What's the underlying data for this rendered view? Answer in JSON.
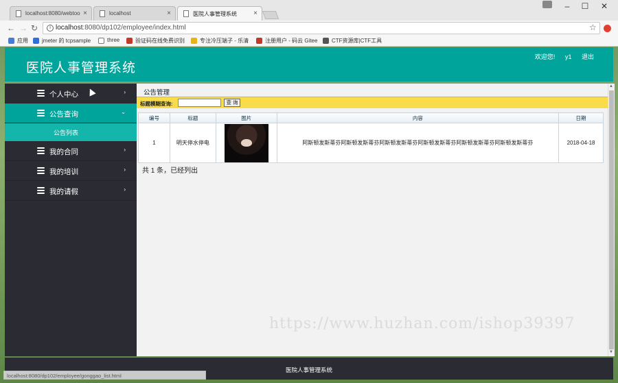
{
  "browser": {
    "tabs": [
      {
        "label": "localhost:8080/webtoo",
        "active": false
      },
      {
        "label": "localhost",
        "active": false
      },
      {
        "label": "医院人事管理系统",
        "active": true
      }
    ],
    "url_host": "localhost",
    "url_path": ":8080/dp102/employee/index.html",
    "bookmarks": [
      {
        "label": "应用",
        "color": "#4a7bd0"
      },
      {
        "label": "jmeter 的 tcpsample",
        "color": "#2f6fd6"
      },
      {
        "label": "three",
        "color": "#777777"
      },
      {
        "label": "验证码在线免费识别",
        "color": "#c0392b"
      },
      {
        "label": "专注冷压端子 - 乐清",
        "color": "#e8b21a"
      },
      {
        "label": "注册用户 - 码云 Gitee",
        "color": "#c0392b"
      },
      {
        "label": "CTF资源库|CTF工具",
        "color": "#555555"
      }
    ],
    "status_text": "localhost:8080/dp102/employee/gonggao_list.html"
  },
  "header": {
    "title": "医院人事管理系统",
    "welcome": "欢迎您!",
    "username": "y1",
    "logout": "退出"
  },
  "sidebar": {
    "items": [
      {
        "label": "个人中心",
        "arrow": "›",
        "active": false
      },
      {
        "label": "公告查询",
        "arrow": "⌄",
        "active": true
      },
      {
        "label": "我的合同",
        "arrow": "›",
        "active": false
      },
      {
        "label": "我的培训",
        "arrow": "›",
        "active": false
      },
      {
        "label": "我的请假",
        "arrow": "›",
        "active": false
      }
    ],
    "submenu": {
      "label": "公告列表"
    }
  },
  "content": {
    "panel_title": "公告管理",
    "search_label": "标题模糊查询:",
    "search_value": "",
    "search_button": "查 询",
    "table": {
      "headers": [
        "编号",
        "标题",
        "图片",
        "内容",
        "日期"
      ],
      "rows": [
        {
          "id": "1",
          "title": "明天停水停电",
          "content": "阿斯顿发斯蒂芬阿斯顿发斯蒂芬阿斯顿发斯蒂芬阿斯顿发斯蒂芬阿斯顿发斯蒂芬阿斯顿发斯蒂芬",
          "date": "2018-04-18"
        }
      ]
    },
    "summary": "共 1 条，已经列出"
  },
  "watermark": "https://www.huzhan.com/ishop39397",
  "footer": {
    "text": "医院人事管理系统"
  },
  "colors": {
    "brand": "#00a49a",
    "sidebar": "#2b2b33",
    "search_bar": "#f8dc4a"
  }
}
